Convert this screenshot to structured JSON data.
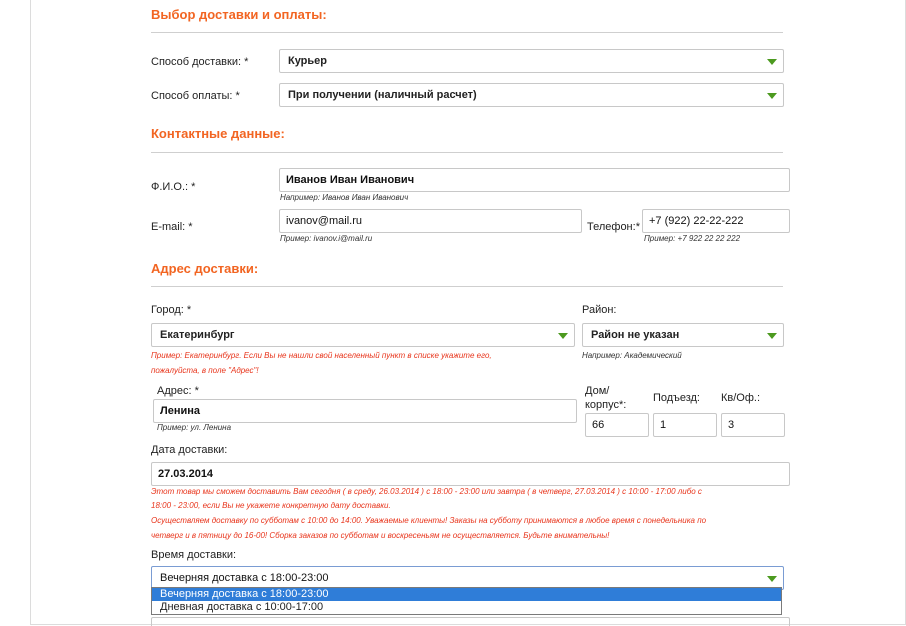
{
  "sections": {
    "delivery_payment": "Выбор доставки и оплаты:",
    "contacts": "Контактные данные:",
    "address": "Адрес доставки:"
  },
  "delivery_method": {
    "label": "Способ доставки: *",
    "value": "Курьер"
  },
  "payment_method": {
    "label": "Способ оплаты: *",
    "value": "При получении (наличный расчет)"
  },
  "fio": {
    "label": "Ф.И.О.: *",
    "value": "Иванов Иван Иванович",
    "hint": "Например: Иванов Иван Иванович"
  },
  "email": {
    "label": "E-mail: *",
    "value": "ivanov@mail.ru",
    "hint": "Пример: ivanov.i@mail.ru"
  },
  "phone": {
    "label": "Телефон:*",
    "value": "+7 (922) 22-22-222",
    "hint": "Пример: +7 922 22 22 222"
  },
  "city": {
    "label": "Город: *",
    "value": "Екатеринбург",
    "hint_line1": "Пример: Екатеринбург. Если Вы не нашли свой населенный пункт в списке укажите его,",
    "hint_line2": "пожалуйста, в поле \"Адрес\"!"
  },
  "district": {
    "label": "Район:",
    "value": "Район не указан",
    "hint": "Например: Академический"
  },
  "street": {
    "label": "Адрес: *",
    "value": "Ленина",
    "hint": "Пример: ул. Ленина"
  },
  "house": {
    "label_line1": "Дом/",
    "label_line2": "корпус*:",
    "value": "66"
  },
  "entrance": {
    "label": "Подъезд:",
    "value": "1"
  },
  "apartment": {
    "label": "Кв/Оф.:",
    "value": "3"
  },
  "delivery_date": {
    "label": "Дата доставки:",
    "value": "27.03.2014",
    "note1_line1": "Этот товар мы сможем доставить Вам сегодня ( в среду, 26.03.2014 ) с 18:00 - 23:00 или завтра ( в четверг, 27.03.2014 ) с 10:00 - 17:00 либо с",
    "note1_line2": "18:00 - 23:00, если Вы не укажете конкретную дату доставки.",
    "note2_line1": "Осуществляем доставку по субботам с 10:00 до 14:00. Уважаемые клиенты! Заказы на субботу принимаются в любое время с понедельника по",
    "note2_line2": "четверг и в пятницу до 16-00! Сборка заказов по субботам и воскресеньям не осуществляется. Будьте внимательны!"
  },
  "delivery_time": {
    "label": "Время доставки:",
    "value": "Вечерняя доставка с 18:00-23:00",
    "options": [
      "Вечерняя доставка с 18:00-23:00",
      "Дневная доставка с 10:00-17:00"
    ]
  }
}
